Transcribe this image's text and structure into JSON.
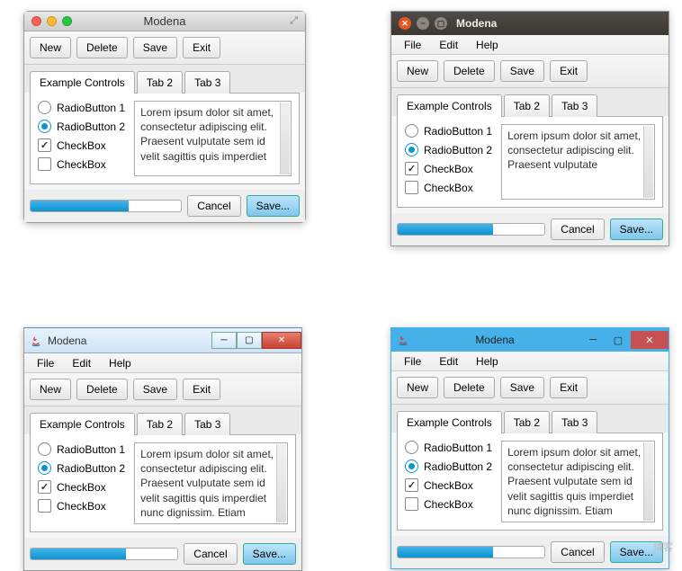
{
  "title": "Modena",
  "menubar": {
    "file": "File",
    "edit": "Edit",
    "help": "Help"
  },
  "toolbar": {
    "new": "New",
    "delete": "Delete",
    "save": "Save",
    "exit": "Exit"
  },
  "tabs": {
    "t1": "Example Controls",
    "t2": "Tab 2",
    "t3": "Tab 3"
  },
  "controls": {
    "radio1": "RadioButton 1",
    "radio2": "RadioButton 2",
    "check1": "CheckBox",
    "check2": "CheckBox"
  },
  "textarea_short": "Lorem ipsum dolor sit amet, consectetur adipiscing elit. Praesent vulputate sem id velit sagittis quis imperdiet",
  "textarea_long": "Lorem ipsum dolor sit amet, consectetur adipiscing elit. Praesent vulputate sem id velit sagittis quis imperdiet nunc dignissim. Etiam",
  "textarea_med": "Lorem ipsum dolor sit amet, consectetur adipiscing elit. Praesent vulputate",
  "footer": {
    "cancel": "Cancel",
    "save": "Save..."
  },
  "progress": 65,
  "watermark": "博客"
}
